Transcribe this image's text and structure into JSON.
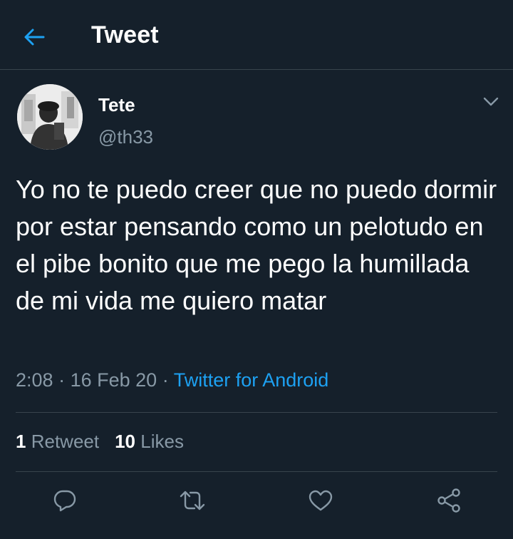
{
  "header": {
    "title": "Tweet",
    "back_icon": "arrow-left-icon"
  },
  "tweet": {
    "author_name": "Tete",
    "author_handle": "@th33",
    "menu_icon": "chevron-down-icon",
    "text": "Yo no te puedo creer que no puedo dormir por estar pensando como un pelotudo en el pibe bonito que me pego la humillada de mi vida me quiero matar",
    "time": "2:08",
    "date": "16 Feb 20",
    "separator": "·",
    "source": "Twitter for Android"
  },
  "stats": {
    "retweets_count": "1",
    "retweets_label": "Retweet",
    "likes_count": "10",
    "likes_label": "Likes"
  },
  "actions": {
    "reply_icon": "reply-icon",
    "retweet_icon": "retweet-icon",
    "like_icon": "heart-icon",
    "share_icon": "share-icon"
  },
  "colors": {
    "background": "#15202b",
    "border": "#38444d",
    "secondary_text": "#8899a6",
    "accent": "#1da1f2"
  }
}
